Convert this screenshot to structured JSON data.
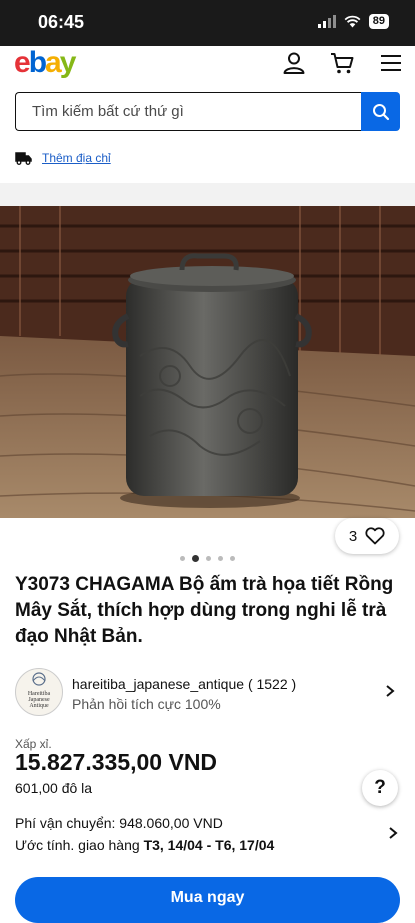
{
  "status_bar": {
    "time": "06:45",
    "battery": "89"
  },
  "header": {
    "logo": {
      "e": "e",
      "b": "b",
      "a": "a",
      "y": "y"
    }
  },
  "search": {
    "placeholder": "Tìm kiếm bất cứ thứ gì"
  },
  "shipping_address": {
    "link": "Thêm địa chỉ"
  },
  "gallery": {
    "favorite_count": "3",
    "image_count": 5,
    "active_index": 1
  },
  "product": {
    "title": "Y3073 CHAGAMA Bộ ấm trà họa tiết Rồng Mây Sắt, thích hợp dùng trong nghi lễ trà đạo Nhật Bản."
  },
  "seller": {
    "avatar_text": [
      "Hareitiba",
      "Japanese",
      "Antique"
    ],
    "name": "hareitiba_japanese_antique",
    "score": "( 1522 )",
    "feedback": "Phản hồi tích cực 100%"
  },
  "price": {
    "label": "Xấp xỉ.",
    "value": "15.827.335,00 VND",
    "alt": "601,00 đô la"
  },
  "shipping": {
    "cost": "Phí vận chuyển: 948.060,00 VND",
    "delivery_prefix": "Ước tính. giao hàng",
    "delivery_range": "T3, 14/04 - T6, 17/04"
  },
  "help": {
    "label": "?"
  },
  "buy": {
    "label": "Mua ngay"
  },
  "colors": {
    "accent": "#0968e5",
    "link": "#1b5ec7"
  }
}
